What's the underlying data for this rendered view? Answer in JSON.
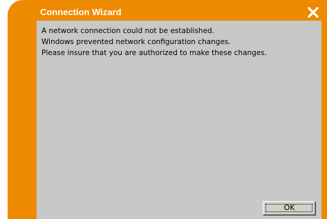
{
  "window": {
    "title": "Connection Wizard",
    "close_icon": "close-x-icon"
  },
  "message": {
    "lines": [
      "A network connection could not be established.",
      "Windows prevented network configuration changes.",
      "Please insure that you are authorized to make these changes."
    ]
  },
  "buttons": {
    "ok_label": "OK"
  },
  "colors": {
    "frame": "#ee8a00",
    "client_background": "#c8c8c8",
    "title_text": "#ffffff"
  }
}
